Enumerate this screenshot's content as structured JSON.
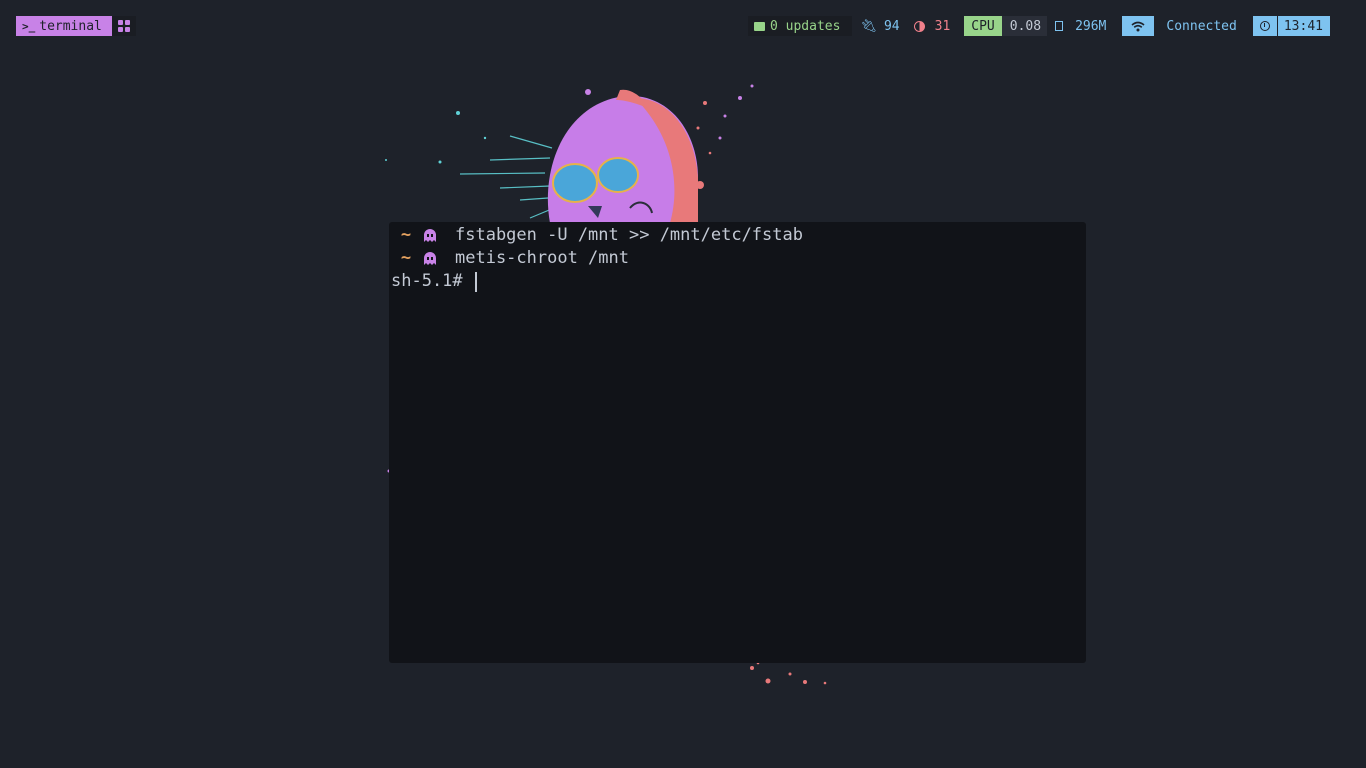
{
  "topbar": {
    "workspace": {
      "label": "terminal",
      "icon": "terminal-prompt-icon"
    },
    "layout": {
      "icon": "grid-layout-icon"
    },
    "updates": {
      "label": "0 updates",
      "icon": "folder-icon"
    },
    "power": {
      "value": "94",
      "icon": "plug-icon"
    },
    "brightness": {
      "value": "31",
      "icon": "brightness-icon"
    },
    "cpu": {
      "label": "CPU",
      "value": "0.08"
    },
    "memory": {
      "value": "296M",
      "icon": "memory-chip-icon"
    },
    "network": {
      "status": "Connected",
      "icon": "wifi-icon"
    },
    "clock": {
      "time": "13:41",
      "icon": "clock-icon"
    }
  },
  "terminal": {
    "lines": [
      {
        "prefix": "~",
        "icon": "ghost-icon",
        "command": "fstabgen -U /mnt >> /mnt/etc/fstab"
      },
      {
        "prefix": "~",
        "icon": "ghost-icon",
        "command": "metis-chroot /mnt"
      }
    ],
    "shell_prompt": "sh-5.1#"
  },
  "colors": {
    "background": "#1e222a",
    "terminal_bg": "#111318",
    "accent_purple": "#c882e7",
    "green": "#98d48a",
    "blue": "#7ec3f0",
    "red": "#f0808b",
    "orange": "#e4a15f",
    "text": "#c3c9d4"
  }
}
